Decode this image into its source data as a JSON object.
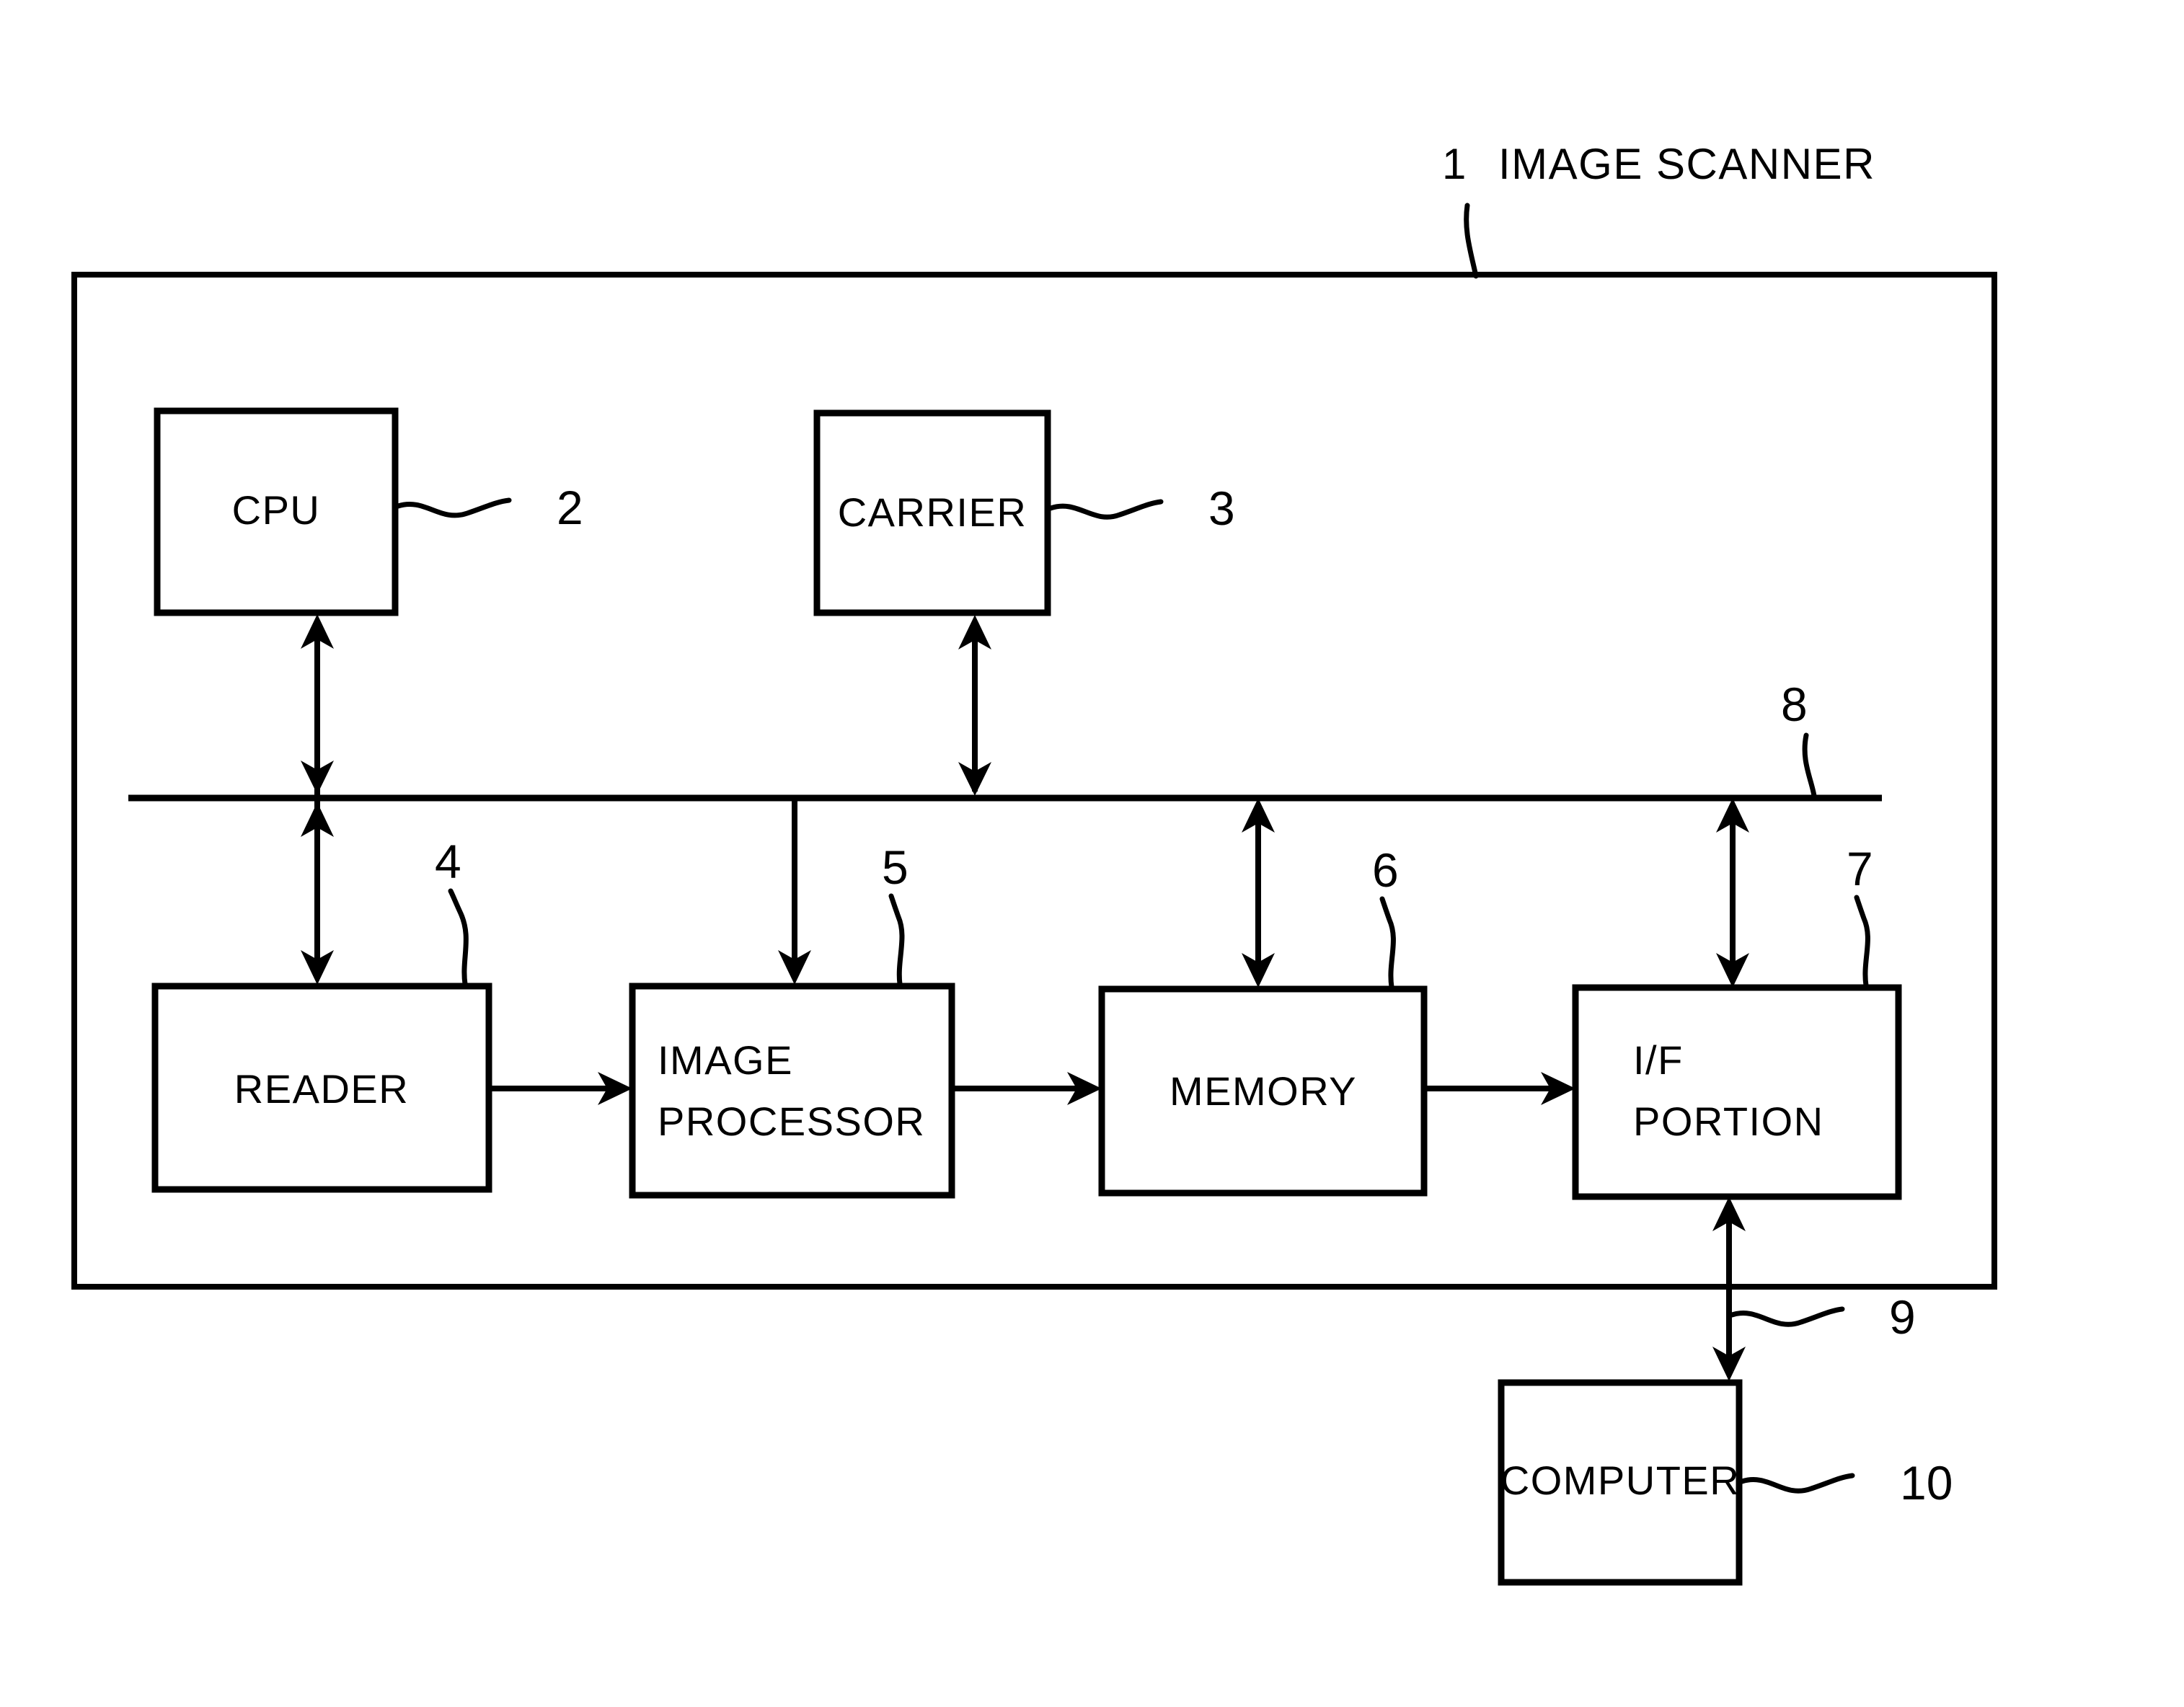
{
  "figure": {
    "title_ref": "1",
    "title_text": "IMAGE SCANNER",
    "enclosure_name": "IMAGE SCANNER"
  },
  "blocks": [
    {
      "id": "cpu",
      "label": "CPU",
      "ref": "2"
    },
    {
      "id": "carrier",
      "label": "CARRIER",
      "ref": "3"
    },
    {
      "id": "reader",
      "label": "READER",
      "ref": "4"
    },
    {
      "id": "image_processor",
      "label_line1": "IMAGE",
      "label_line2": "PROCESSOR",
      "ref": "5"
    },
    {
      "id": "memory",
      "label": "MEMORY",
      "ref": "6"
    },
    {
      "id": "if_portion",
      "label_line1": "I/F",
      "label_line2": "PORTION",
      "ref": "7"
    },
    {
      "id": "computer",
      "label": "COMPUTER",
      "ref": "10"
    }
  ],
  "connections": [
    {
      "id": "bus",
      "ref": "8",
      "kind": "bus-line"
    },
    {
      "id": "if-to-computer",
      "ref": "9",
      "kind": "bidirectional"
    },
    {
      "id": "cpu-bus-reader",
      "ref": "",
      "kind": "bidirectional"
    },
    {
      "id": "carrier-to-bus",
      "ref": "",
      "kind": "bidirectional"
    },
    {
      "id": "bus-to-image-processor",
      "ref": "",
      "kind": "unidirectional"
    },
    {
      "id": "memory-to-bus",
      "ref": "",
      "kind": "bidirectional"
    },
    {
      "id": "if-to-bus",
      "ref": "",
      "kind": "bidirectional"
    },
    {
      "id": "reader-to-image-processor",
      "ref": "",
      "kind": "unidirectional"
    },
    {
      "id": "image-processor-to-memory",
      "ref": "",
      "kind": "unidirectional"
    },
    {
      "id": "memory-to-if",
      "ref": "",
      "kind": "unidirectional"
    }
  ],
  "colors": {
    "ink": "#000000",
    "paper": "#ffffff"
  }
}
